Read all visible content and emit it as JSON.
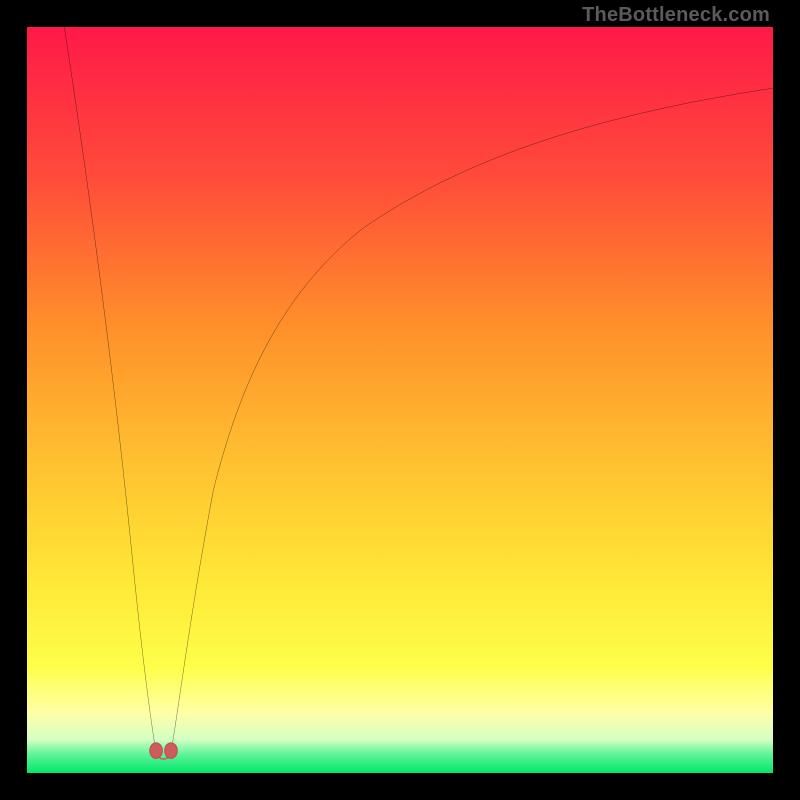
{
  "watermark": "TheBottleneck.com",
  "colors": {
    "bg_black": "#000000",
    "top_red": "#ff1948",
    "mid_orange": "#ff8f2a",
    "mid_yellow": "#ffe736",
    "pale_yellow": "#ffff97",
    "green": "#28e57b",
    "bright_green": "#00f06a",
    "curve_stroke": "#000000",
    "marker_fill": "#cf5c5c",
    "marker_stroke": "#b94b4b",
    "watermark_gray": "#5b5b5b"
  },
  "chart_data": {
    "type": "line",
    "title": "",
    "xlabel": "",
    "ylabel": "",
    "xlim": [
      0,
      100
    ],
    "ylim": [
      0,
      100
    ],
    "curve": {
      "description": "Bottleneck percentage curve with sharp V-shaped minimum near x≈18 and asymptotic rise toward high x",
      "x": [
        5,
        8,
        10,
        12,
        14,
        16,
        17,
        18,
        19,
        20,
        22,
        25,
        30,
        35,
        40,
        50,
        60,
        70,
        80,
        90,
        100
      ],
      "y": [
        100,
        80,
        62,
        45,
        30,
        14,
        6,
        2,
        6,
        13,
        25,
        38,
        52,
        61,
        67,
        76,
        82,
        86,
        89,
        91,
        92
      ]
    },
    "markers": {
      "description": "Highlighted near-optimal band around minimum",
      "points": [
        {
          "x": 17.3,
          "y": 2.0
        },
        {
          "x": 19.3,
          "y": 2.0
        }
      ]
    },
    "background_gradient_meaning": "color encodes bottleneck severity: green=good (low y), red=bad (high y)"
  }
}
